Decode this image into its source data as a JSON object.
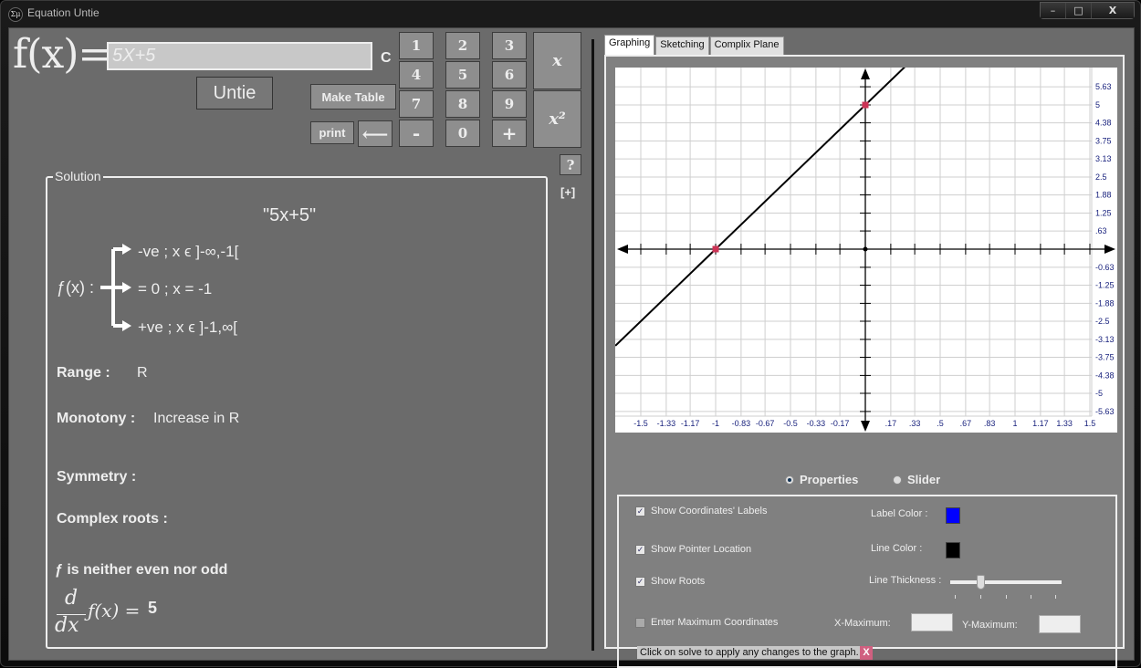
{
  "window": {
    "title": "Equation Untie",
    "icon_text": "Σμ",
    "controls": {
      "minimize": "–",
      "maximize": "□",
      "close": "X"
    }
  },
  "input": {
    "fx_label": "f(x)=",
    "equation_value": "5X+5",
    "clear_label": "C",
    "untie_label": "Untie",
    "make_table_label": "Make Table",
    "print_label": "print",
    "backspace_label": "⟵"
  },
  "keypad": {
    "keys": [
      "1",
      "2",
      "3",
      "4",
      "5",
      "6",
      "7",
      "8",
      "9",
      "-",
      "0",
      "+"
    ],
    "x_label": "x",
    "x2_label": "x²",
    "help_label": "?",
    "expand_label": "[+]"
  },
  "solution": {
    "legend": "Solution",
    "expression": "\"5x+5\"",
    "sign_label": "ƒ(x) :",
    "sign_cases": [
      "-ve ; x ϵ ]-∞,-1[",
      "= 0 ; x =  -1",
      "+ve ; x ϵ ]-1,∞["
    ],
    "range_label": "Range :",
    "range_value": "R",
    "monotony_label": "Monotony :",
    "monotony_value": "Increase in R",
    "symmetry_label": "Symmetry :",
    "complex_roots_label": "Complex roots :",
    "parity_text": "ƒ is neither even nor odd",
    "derivative_num": "d",
    "derivative_den": "dx",
    "derivative_fx": "ƒ(x) =",
    "derivative_value": "5"
  },
  "tabs": [
    {
      "label": "Graphing",
      "active": true
    },
    {
      "label": "Sketching",
      "active": false
    },
    {
      "label": "Complix Plane",
      "active": false
    }
  ],
  "chart_data": {
    "type": "line",
    "title": "",
    "function": "5x+5",
    "x_range": [
      -1.67,
      1.67
    ],
    "y_range": [
      -5.95,
      6.3
    ],
    "x_ticks": [
      -1.5,
      -1.33,
      -1.17,
      -1,
      -0.83,
      -0.67,
      -0.5,
      -0.33,
      -0.17,
      0.17,
      0.33,
      0.5,
      0.67,
      0.83,
      1,
      1.17,
      1.33,
      1.5
    ],
    "x_tick_labels": [
      "-1.5",
      "-1.33",
      "-1.17",
      "-1",
      "-0.83",
      "-0.67",
      "-0.5",
      "-0.33",
      "-0.17",
      ".17",
      ".33",
      ".5",
      ".67",
      ".83",
      "1",
      "1.17",
      "1.33",
      "1.5"
    ],
    "y_ticks": [
      5.63,
      5,
      4.38,
      3.75,
      3.13,
      2.5,
      1.88,
      1.25,
      0.63,
      -0.63,
      -1.25,
      -1.88,
      -2.5,
      -3.13,
      -3.75,
      -4.38,
      -5,
      -5.63
    ],
    "y_tick_labels": [
      "5.63",
      "5",
      "4.38",
      "3.75",
      "3.13",
      "2.5",
      "1.88",
      "1.25",
      ".63",
      "-0.63",
      "-1.25",
      "-1.88",
      "-2.5",
      "-3.13",
      "-3.75",
      "-4.38",
      "-5",
      "-5.63"
    ],
    "series": [
      {
        "name": "f(x)",
        "x": [
          -1.67,
          1.67
        ],
        "y": [
          -3.35,
          13.35
        ],
        "color": "#000000"
      }
    ],
    "marked_points": [
      {
        "label": "root",
        "x": -1,
        "y": 0
      },
      {
        "label": "y-intercept",
        "x": 0,
        "y": 5
      }
    ],
    "point_color": "#cc3355",
    "label_color": "#1a237e",
    "grid": true
  },
  "view_mode": {
    "options": [
      {
        "label": "Properties",
        "selected": true
      },
      {
        "label": "Slider",
        "selected": false
      }
    ]
  },
  "properties": {
    "show_coord_labels": {
      "label": "Show Coordinates' Labels",
      "checked": true
    },
    "show_pointer": {
      "label": "Show Pointer Location",
      "checked": true
    },
    "show_roots": {
      "label": "Show Roots",
      "checked": true
    },
    "enter_max": {
      "label": "Enter Maximum Coordinates",
      "checked": false
    },
    "label_color_label": "Label Color :",
    "label_color": "#0000ff",
    "line_color_label": "Line Color :",
    "line_color": "#000000",
    "line_thickness_label": "Line Thickness :",
    "line_thickness_level": 2,
    "line_thickness_max": 5,
    "x_max_label": "X-Maximum:",
    "x_max_value": "",
    "y_max_label": "Y-Maximum:",
    "y_max_value": "",
    "hint": "Click on solve to apply any changes to the graph.",
    "hint_close": "X"
  }
}
